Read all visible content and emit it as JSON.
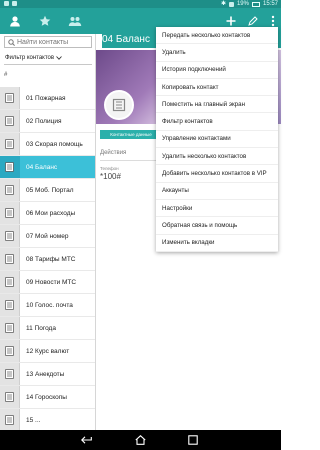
{
  "status_bar": {
    "battery": "19%",
    "time": "15:57"
  },
  "header": {
    "tabs": [
      {
        "icon": "person-icon"
      },
      {
        "icon": "star-icon"
      },
      {
        "icon": "group-icon"
      }
    ],
    "actions": [
      {
        "icon": "add-icon"
      },
      {
        "icon": "edit-icon"
      },
      {
        "icon": "overflow-menu-icon"
      }
    ]
  },
  "search": {
    "placeholder": "Найти контакты"
  },
  "filter": {
    "label": "Фильтр контактов"
  },
  "list": {
    "index_letter": "#",
    "items": [
      {
        "label": "01 Пожарная"
      },
      {
        "label": "02 Полиция"
      },
      {
        "label": "03 Скорая помощь"
      },
      {
        "label": "04 Баланс"
      },
      {
        "label": "05 Моб. Портал"
      },
      {
        "label": "06 Мои расходы"
      },
      {
        "label": "07 Мой номер"
      },
      {
        "label": "08 Тарифы МТС"
      },
      {
        "label": "09 Новости МТС"
      },
      {
        "label": "10 Голос. почта"
      },
      {
        "label": "11 Погода"
      },
      {
        "label": "12 Курс валют"
      },
      {
        "label": "13 Анекдоты"
      },
      {
        "label": "14 Гороскопы"
      },
      {
        "label": "15 ..."
      }
    ],
    "selected_index": 3
  },
  "detail": {
    "title": "04 Баланс",
    "contact_button": "Контактные данные",
    "section": "Действия",
    "phone_label": "Телефон",
    "phone_value": "*100#"
  },
  "menu": {
    "items": [
      "Передать несколько контактов",
      "Удалить",
      "История подключений",
      "Копировать контакт",
      "Поместить на главный экран",
      "Фильтр контактов",
      "Управление контактами",
      "Удалить несколько контактов",
      "Добавить несколько контактов в VIP",
      "Аккаунты",
      "Настройки",
      "Обратная связь и помощь",
      "Изменить вкладки"
    ]
  },
  "colors": {
    "header": "#23a19a",
    "status_bar": "#1e8e88",
    "selected_row": "#3cc0d8",
    "contact_button": "#2bb0ab"
  }
}
